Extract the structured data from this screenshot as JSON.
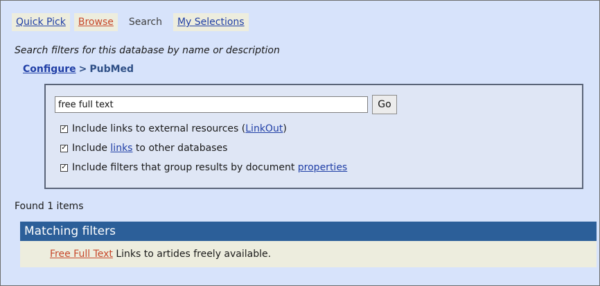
{
  "tabs": [
    {
      "label": "Quick Pick"
    },
    {
      "label": "Browse"
    },
    {
      "label": "Search"
    },
    {
      "label": "My Selections"
    }
  ],
  "description": "Search filters for this database by name or description",
  "breadcrumb": {
    "link": "Configure",
    "separator": ">",
    "current": "PubMed"
  },
  "search": {
    "value": "free full text",
    "button": "Go"
  },
  "options": [
    {
      "checked": true,
      "before": "Include links to external resources (",
      "link": "LinkOut",
      "after": ")"
    },
    {
      "checked": true,
      "before": "Include ",
      "link": "links",
      "after": " to other databases"
    },
    {
      "checked": true,
      "before": "Include filters that group results by document ",
      "link": "properties",
      "after": ""
    }
  ],
  "found": "Found 1 items",
  "matching_header": "Matching filters",
  "result": {
    "link": "Free Full Text",
    "text": "Links to artides freely available."
  },
  "colors": {
    "background": "#d7e3fb",
    "header_bar": "#2c5f99",
    "link_blue": "#1f3ea6",
    "link_orange": "#c7472a",
    "tab_bg": "#ededde"
  }
}
